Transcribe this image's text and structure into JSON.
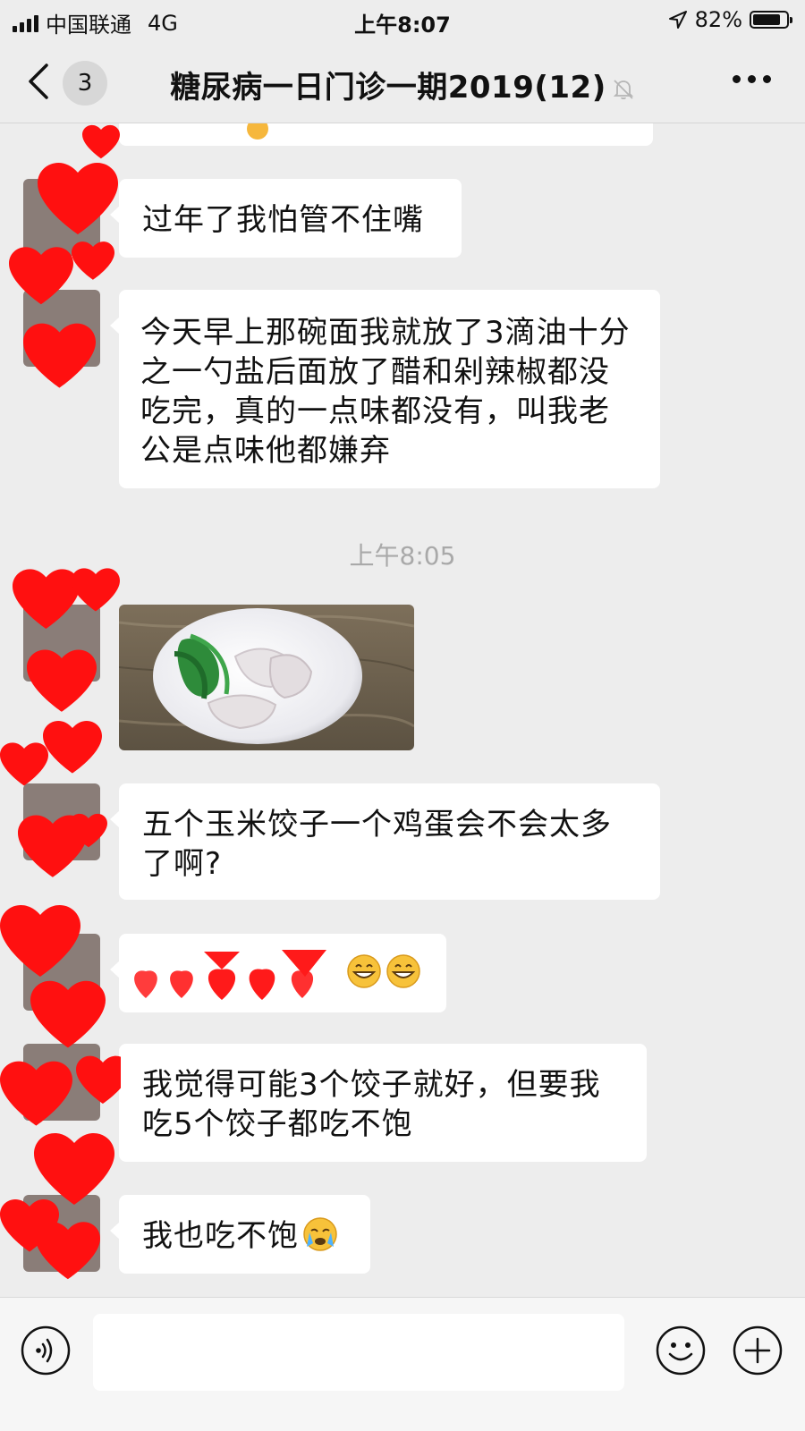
{
  "status_bar": {
    "carrier": "中国联通",
    "network": "4G",
    "time": "上午8:07",
    "battery_percent": "82%",
    "battery_level": 0.82
  },
  "header": {
    "back_badge": "3",
    "title": "糖尿病一日门诊一期2019(12)",
    "icons": [
      "chevron-left-icon",
      "bell-muted-icon",
      "more-dots-icon"
    ]
  },
  "messages": [
    {
      "type": "text",
      "text": "过年了我怕管不住嘴"
    },
    {
      "type": "text",
      "text": "今天早上那碗面我就放了3滴油十分之一勺盐后面放了醋和剁辣椒都没吃完，真的一点味都没有，叫我老公是点味他都嫌弃"
    },
    {
      "type": "timestamp",
      "text": "上午8:05"
    },
    {
      "type": "image",
      "icon": "photo-dumplings-greens-egg"
    },
    {
      "type": "text",
      "text": "五个玉米饺子一个鸡蛋会不会太多了啊?"
    },
    {
      "type": "text",
      "text": "",
      "emoji": [
        "grinning-face-icon",
        "grinning-face-icon"
      ]
    },
    {
      "type": "text",
      "text": "我觉得可能3个饺子就好，但要我吃5个饺子都吃不饱"
    },
    {
      "type": "text",
      "text": "我也吃不饱",
      "emoji": [
        "crying-face-icon"
      ]
    }
  ],
  "input_bar": {
    "placeholder": "",
    "icons": [
      "voice-icon",
      "emoji-icon",
      "plus-icon"
    ]
  },
  "colors": {
    "background": "#ededed",
    "bubble": "#ffffff",
    "redaction_heart": "#ff1a1a",
    "timestamp": "#a9a9a9"
  }
}
